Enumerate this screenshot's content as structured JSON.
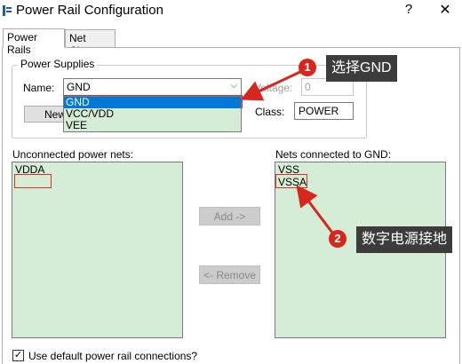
{
  "window": {
    "title": "Power Rail Configuration",
    "help_glyph": "?",
    "close_glyph": "✕"
  },
  "tabs": [
    {
      "label": "Power Rails"
    },
    {
      "label": "Net Class"
    }
  ],
  "power_supplies": {
    "group_title": "Power Supplies",
    "name_label": "Name:",
    "name_value": "GND",
    "options": [
      "GND",
      "VCC/VDD",
      "VEE"
    ],
    "new_button": "New",
    "voltage_label": "Voltage:",
    "voltage_value": "0",
    "class_label": "Class:",
    "class_value": "POWER"
  },
  "unconnected": {
    "label": "Unconnected power nets:",
    "items": [
      "VDDA"
    ]
  },
  "connected": {
    "label": "Nets connected to GND:",
    "items": [
      "VSS",
      "VSSA"
    ]
  },
  "buttons": {
    "add": "Add ->",
    "remove": "<- Remove"
  },
  "checkbox": {
    "label": "Use default power rail connections?",
    "checked": true
  },
  "annotations": [
    {
      "number": "1",
      "text": "选择GND"
    },
    {
      "number": "2",
      "text": "数字电源接地"
    }
  ],
  "colors": {
    "list_bg": "#d5ecd6",
    "selection": "#0078d7",
    "annotation_red": "#d9261c",
    "callout_bg": "#3c3c3c"
  }
}
